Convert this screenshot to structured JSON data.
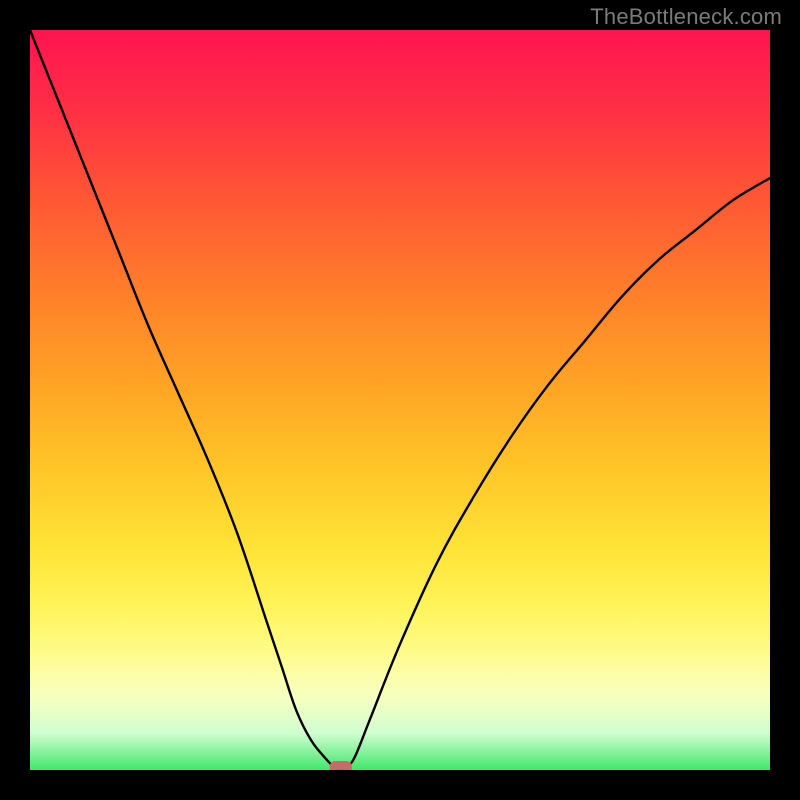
{
  "watermark": "TheBottleneck.com",
  "chart_data": {
    "type": "line",
    "title": "",
    "xlabel": "",
    "ylabel": "",
    "xlim": [
      0,
      100
    ],
    "ylim": [
      0,
      100
    ],
    "x": [
      0,
      4,
      8,
      12,
      16,
      20,
      24,
      28,
      32,
      34,
      36,
      38,
      40,
      41,
      42,
      43,
      44,
      46,
      50,
      55,
      60,
      65,
      70,
      75,
      80,
      85,
      90,
      95,
      100
    ],
    "values": [
      100,
      90,
      80,
      70,
      60,
      51,
      42,
      32,
      20,
      14,
      8,
      4,
      1.5,
      0.6,
      0.4,
      0.6,
      2,
      7,
      17,
      28,
      37,
      45,
      52,
      58,
      64,
      69,
      73,
      77,
      80
    ],
    "marker": {
      "x": 42,
      "y": 0.4
    },
    "colors": {
      "curve": "#000000",
      "marker": "#c96a6a",
      "gradient_top": "#ff1450",
      "gradient_bottom": "#42e66a"
    }
  }
}
